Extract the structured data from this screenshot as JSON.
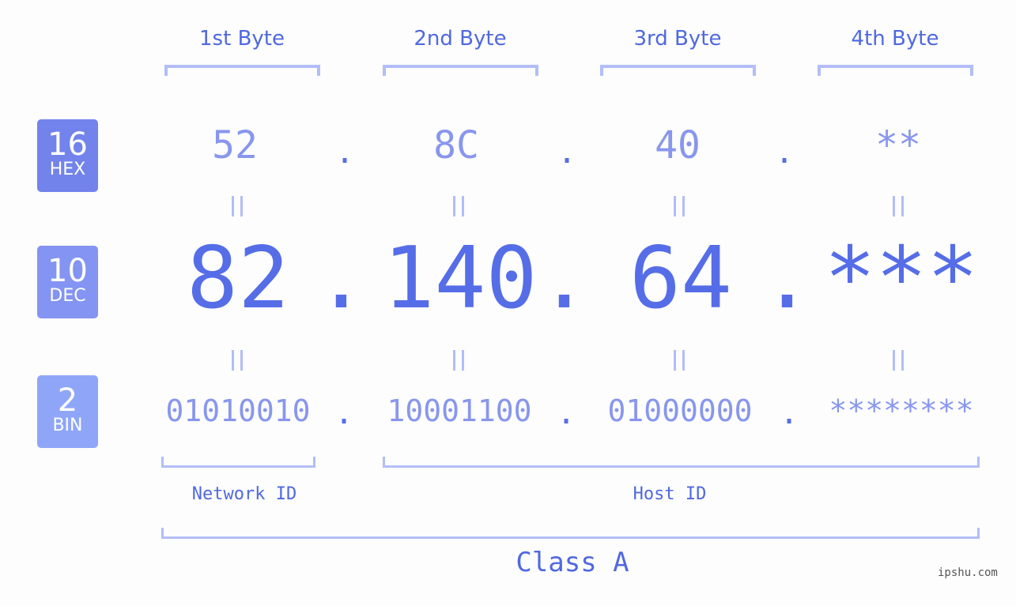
{
  "bytes_header": [
    "1st Byte",
    "2nd Byte",
    "3rd Byte",
    "4th Byte"
  ],
  "rows": {
    "hex": {
      "base": "16",
      "label": "HEX",
      "values": [
        "52",
        "8C",
        "40",
        "**"
      ]
    },
    "dec": {
      "base": "10",
      "label": "DEC",
      "values": [
        "82",
        "140",
        "64",
        "***"
      ]
    },
    "bin": {
      "base": "2",
      "label": "BIN",
      "values": [
        "01010010",
        "10001100",
        "01000000",
        "********"
      ]
    }
  },
  "separator": ".",
  "network_label": "Network ID",
  "host_label": "Host ID",
  "class_label": "Class A",
  "watermark": "ipshu.com",
  "colors": {
    "hex_badge": "#7383ec",
    "dec_badge": "#8494f2",
    "bin_badge": "#8fa6f8",
    "accent": "#566de8",
    "light": "#8896ee",
    "bracket": "#b3bdf7"
  }
}
